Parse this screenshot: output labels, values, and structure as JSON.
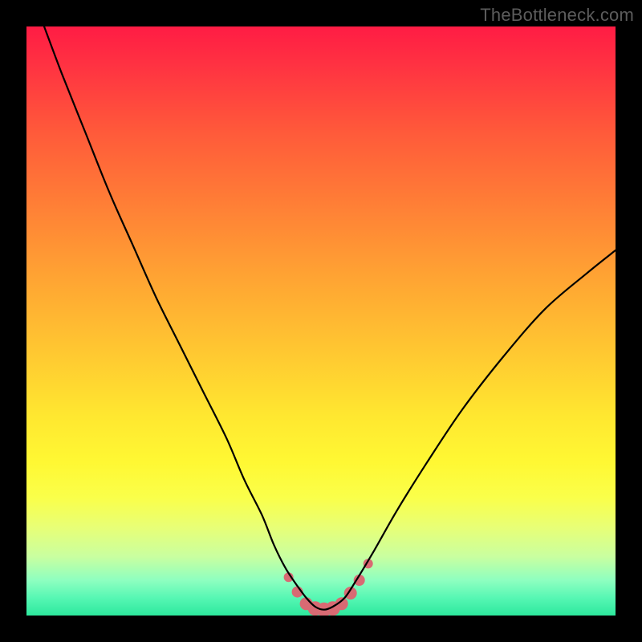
{
  "watermark": "TheBottleneck.com",
  "colors": {
    "frame": "#000000",
    "curve": "#000000",
    "marker": "#d86a73"
  },
  "chart_data": {
    "type": "line",
    "title": "",
    "xlabel": "",
    "ylabel": "",
    "xlim": [
      0,
      100
    ],
    "ylim": [
      0,
      100
    ],
    "grid": false,
    "legend": false,
    "series": [
      {
        "name": "bottleneck-curve",
        "x": [
          3,
          6,
          10,
          14,
          18,
          22,
          26,
          30,
          34,
          37,
          40,
          42,
          44,
          46,
          47.5,
          49,
          50.5,
          52,
          54,
          56,
          59,
          63,
          68,
          74,
          81,
          88,
          95,
          100
        ],
        "y": [
          100,
          92,
          82,
          72,
          63,
          54,
          46,
          38,
          30,
          23,
          17,
          12,
          8,
          5,
          3,
          1.5,
          1,
          1.5,
          3,
          6,
          11,
          18,
          26,
          35,
          44,
          52,
          58,
          62
        ]
      }
    ],
    "markers": {
      "name": "minimum-band",
      "points": [
        {
          "x": 44.5,
          "y": 6.5,
          "r": 6
        },
        {
          "x": 46.0,
          "y": 4.0,
          "r": 7
        },
        {
          "x": 47.5,
          "y": 2.0,
          "r": 8
        },
        {
          "x": 49.0,
          "y": 1.2,
          "r": 9
        },
        {
          "x": 50.5,
          "y": 1.0,
          "r": 9
        },
        {
          "x": 52.0,
          "y": 1.2,
          "r": 9
        },
        {
          "x": 53.5,
          "y": 2.0,
          "r": 8
        },
        {
          "x": 55.0,
          "y": 3.8,
          "r": 8
        },
        {
          "x": 56.5,
          "y": 6.0,
          "r": 7
        },
        {
          "x": 58.0,
          "y": 8.8,
          "r": 6
        }
      ]
    }
  }
}
